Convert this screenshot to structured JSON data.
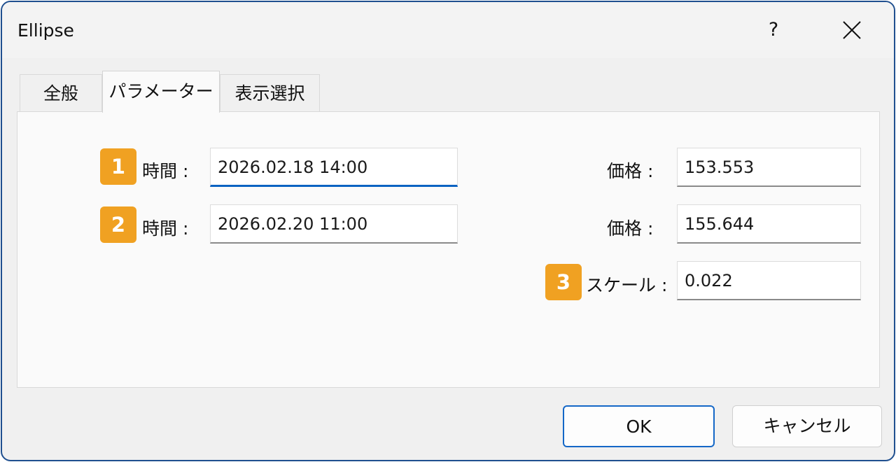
{
  "window": {
    "title": "Ellipse",
    "help_label": "?"
  },
  "tabs": [
    {
      "label": "全般"
    },
    {
      "label": "パラメーター"
    },
    {
      "label": "表示選択"
    }
  ],
  "params": {
    "time1": {
      "badge": "1",
      "label": "時間 :",
      "value": "2026.02.18 14:00"
    },
    "time2": {
      "badge": "2",
      "label": "時間 :",
      "value": "2026.02.20 11:00"
    },
    "price1": {
      "label": "価格 :",
      "value": "153.553"
    },
    "price2": {
      "label": "価格 :",
      "value": "155.644"
    },
    "scale": {
      "badge": "3",
      "label": "スケール :",
      "value": "0.022"
    }
  },
  "buttons": {
    "ok": "OK",
    "cancel": "キャンセル"
  },
  "colors": {
    "badge": "#f0a122",
    "focus_accent": "#0a63c2",
    "window_border": "#1f4f8f"
  }
}
